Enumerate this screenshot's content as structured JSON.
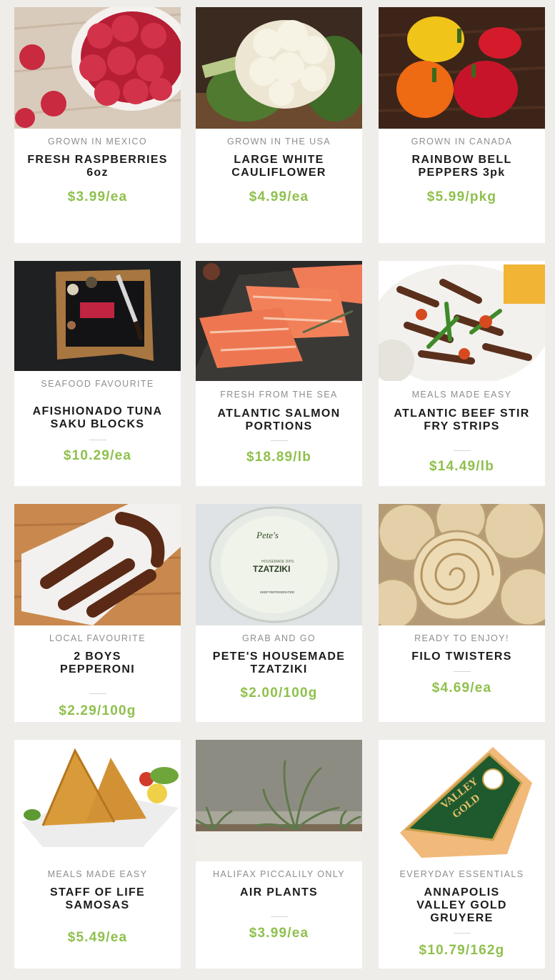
{
  "products": [
    {
      "origin": "GROWN IN MEXICO",
      "title": "FRESH RASPBERRIES 6oz",
      "price": "$3.99/ea",
      "image": "raspberries-photo"
    },
    {
      "origin": "GROWN IN THE USA",
      "title": "LARGE WHITE CAULIFLOWER",
      "price": "$4.99/ea",
      "image": "cauliflower-photo"
    },
    {
      "origin": "GROWN IN CANADA",
      "title": "RAINBOW BELL PEPPERS 3pk",
      "price": "$5.99/pkg",
      "image": "bell-peppers-photo"
    },
    {
      "origin": "SEAFOOD FAVOURITE",
      "title": "AFISHIONADO TUNA SAKU BLOCKS",
      "price": "$10.29/ea",
      "image": "tuna-board-photo"
    },
    {
      "origin": "FRESH FROM THE SEA",
      "title": "ATLANTIC SALMON PORTIONS",
      "price": "$18.89/lb",
      "image": "salmon-photo"
    },
    {
      "origin": "MEALS MADE EASY",
      "title": "ATLANTIC BEEF STIR FRY STRIPS",
      "price": "$14.49/lb",
      "image": "stir-fry-photo"
    },
    {
      "origin": "LOCAL FAVOURITE",
      "title": "2 BOYS PEPPERONI",
      "price": "$2.29/100g",
      "image": "pepperoni-photo"
    },
    {
      "origin": "GRAB AND GO",
      "title": "PETE'S HOUSEMADE TZATZIKI",
      "price": "$2.00/100g",
      "image": "tzatziki-tub-photo",
      "label": {
        "brand": "Pete's",
        "sub": "HOUSEMADE DIPS",
        "name": "TZATZIKI",
        "note": "KEEP REFRIGERATED"
      }
    },
    {
      "origin": "READY TO ENJOY!",
      "title": "FILO TWISTERS",
      "price": "$4.69/ea",
      "image": "filo-twisters-photo"
    },
    {
      "origin": "MEALS MADE EASY",
      "title": "STAFF OF LIFE SAMOSAS",
      "price": "$5.49/ea",
      "image": "samosas-photo"
    },
    {
      "origin": "HALIFAX PICCALILY ONLY",
      "title": "AIR PLANTS",
      "price": "$3.99/ea",
      "image": "air-plants-photo"
    },
    {
      "origin": "EVERYDAY ESSENTIALS",
      "title": "ANNAPOLIS VALLEY GOLD GRUYERE",
      "price": "$10.79/162g",
      "image": "gruyere-cheese-photo",
      "label": {
        "line1": "VALLEY",
        "line2": "GOLD"
      }
    }
  ]
}
